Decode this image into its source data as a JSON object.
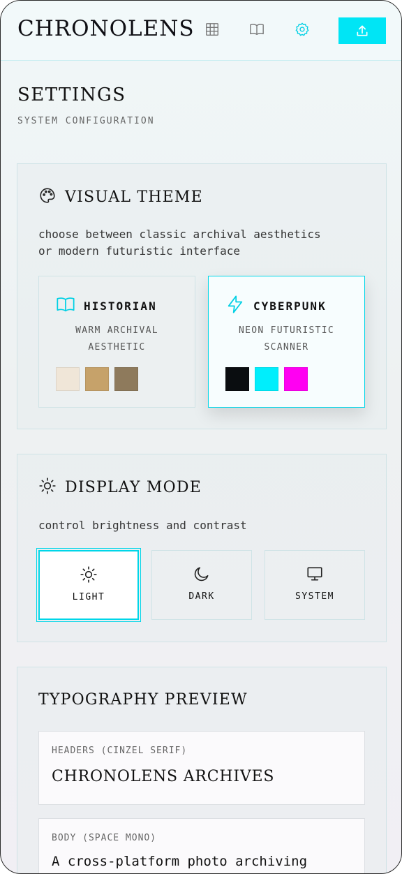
{
  "app": {
    "title": "CHRONOLENS"
  },
  "header": {
    "nav": [
      {
        "icon": "grid-icon"
      },
      {
        "icon": "book-icon"
      },
      {
        "icon": "settings-icon",
        "active": true
      }
    ],
    "upload_icon": "upload-icon"
  },
  "page": {
    "title": "SETTINGS",
    "subtitle": "SYSTEM CONFIGURATION"
  },
  "visual_theme": {
    "title": "VISUAL THEME",
    "desc_line1": "choose between classic archival aesthetics",
    "desc_line2": "or modern futuristic interface",
    "options": [
      {
        "name": "HISTORIAN",
        "desc_line1": "WARM ARCHIVAL",
        "desc_line2": "AESTHETIC",
        "swatches": [
          "#f0e6d8",
          "#c6a26a",
          "#8e7a5c"
        ],
        "selected": false
      },
      {
        "name": "CYBERPUNK",
        "desc_line1": "NEON FUTURISTIC",
        "desc_line2": "SCANNER",
        "swatches": [
          "#0a0d10",
          "#00eefc",
          "#ff00f2"
        ],
        "selected": true
      }
    ]
  },
  "display_mode": {
    "title": "DISPLAY MODE",
    "desc": "control brightness and contrast",
    "options": [
      {
        "label": "LIGHT",
        "icon": "sun-icon",
        "selected": true
      },
      {
        "label": "DARK",
        "icon": "moon-icon",
        "selected": false
      },
      {
        "label": "SYSTEM",
        "icon": "monitor-icon",
        "selected": false
      }
    ]
  },
  "typography": {
    "title": "TYPOGRAPHY PREVIEW",
    "headers_caption": "HEADERS (CINZEL SERIF)",
    "headers_sample": "CHRONOLENS ARCHIVES",
    "body_caption": "BODY (SPACE MONO)",
    "body_sample": "A cross-platform photo archiving"
  },
  "colors": {
    "accent": "#00e5f5",
    "text": "#111111"
  }
}
